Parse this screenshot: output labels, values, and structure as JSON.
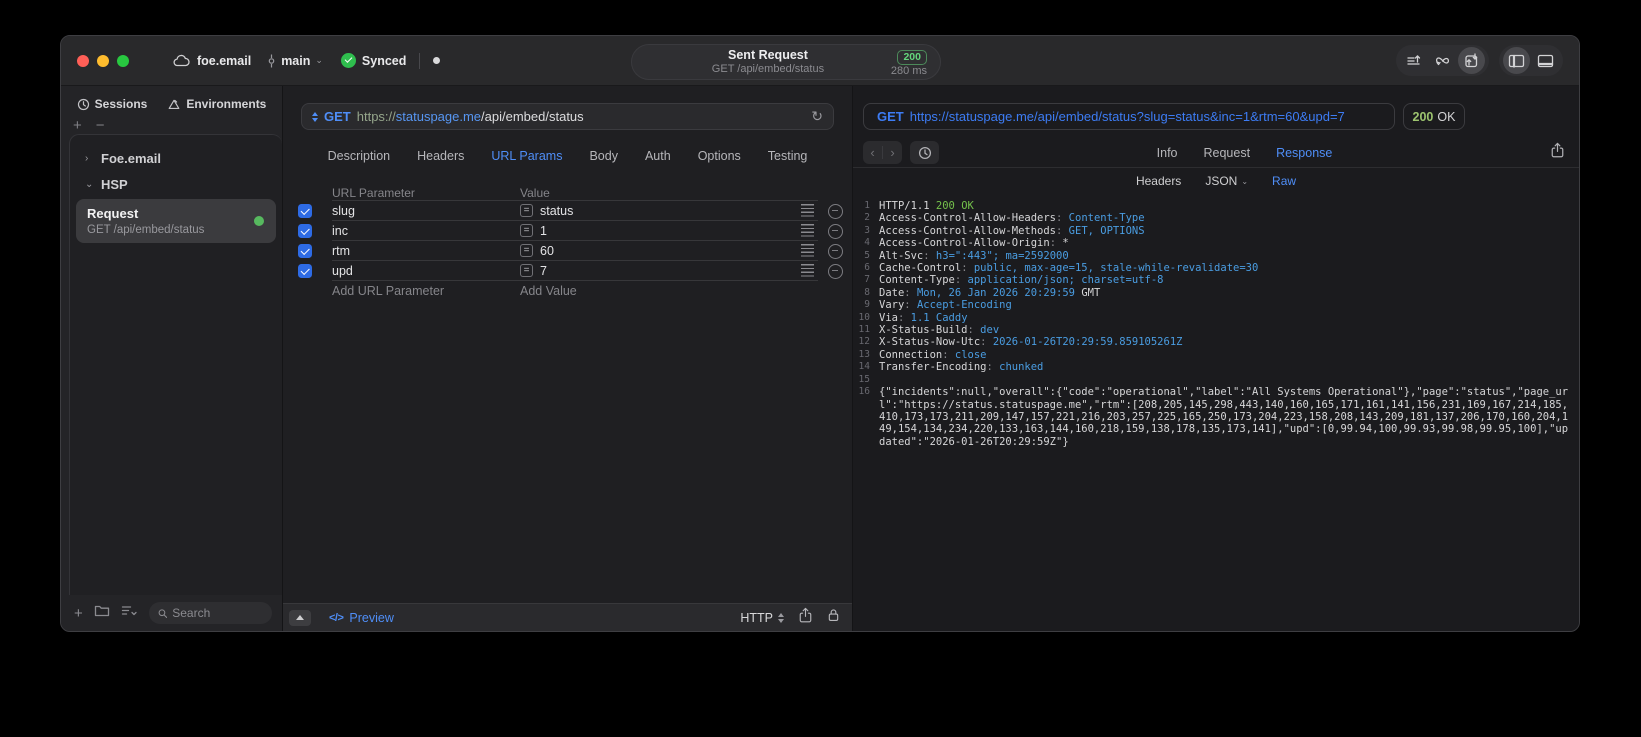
{
  "colors": {
    "accent_blue": "#4f8ef7",
    "value_blue": "#4a9de2",
    "response_green": "#74c14b",
    "badge_green": "#64d67c",
    "traffic_red": "#ff5f57",
    "traffic_yellow": "#febc2e",
    "traffic_green": "#28c840"
  },
  "icons": {
    "cloud": "cloud-outline",
    "branch": "git-commit",
    "synced": "check-circle",
    "list_up": "lines-arrow-up",
    "loop": "loop-arrows",
    "transfer": "box-transfer-arrows",
    "sidebar_left": "panel-left",
    "panel_bottom": "panel-bottom",
    "sessions": "clock",
    "environments": "triangle",
    "search": "magnifier",
    "refresh": "↻",
    "preview_code": "</>",
    "share": "square-arrow-up",
    "lock": "padlock",
    "history": "clock",
    "back": "‹",
    "forward": "›",
    "chevron_down": "⌄",
    "chevron_right": "›",
    "equals": "=",
    "remove": "minus-circle",
    "drag": "hamburger-lines"
  },
  "titlebar": {
    "project": "foe.email",
    "branch": "main",
    "sync_label": "Synced",
    "request": {
      "title": "Sent Request",
      "subtitle": "GET /api/embed/status",
      "status": "200",
      "duration": "280 ms"
    }
  },
  "sidebar": {
    "tabs": [
      {
        "label": "Sessions"
      },
      {
        "label": "Environments"
      }
    ],
    "tree": {
      "group1": "Foe.email",
      "group2": "HSP"
    },
    "request_item": {
      "title": "Request",
      "subtitle": "GET /api/embed/status"
    },
    "search_placeholder": "Search"
  },
  "request_editor": {
    "method": "GET",
    "url": {
      "scheme": "https://",
      "host": "statuspage.me",
      "path": "/api/embed/status"
    },
    "tabs": [
      "Description",
      "Headers",
      "URL Params",
      "Body",
      "Auth",
      "Options",
      "Testing"
    ],
    "active_tab": "URL Params",
    "params": {
      "columns": [
        "URL Parameter",
        "Value"
      ],
      "rows": [
        {
          "enabled": true,
          "name": "slug",
          "value": "status"
        },
        {
          "enabled": true,
          "name": "inc",
          "value": "1"
        },
        {
          "enabled": true,
          "name": "rtm",
          "value": "60"
        },
        {
          "enabled": true,
          "name": "upd",
          "value": "7"
        }
      ],
      "add_row": {
        "name_placeholder": "Add URL Parameter",
        "value_placeholder": "Add Value"
      }
    },
    "footer": {
      "preview_label": "Preview",
      "protocol_label": "HTTP"
    }
  },
  "response_viewer": {
    "request_line": {
      "method": "GET",
      "url": "https://statuspage.me/api/embed/status?slug=status&inc=1&rtm=60&upd=7"
    },
    "status": {
      "code": "200",
      "text": "OK"
    },
    "tabs": [
      "Info",
      "Request",
      "Response"
    ],
    "active_tab": "Response",
    "subtabs": [
      "Headers",
      "JSON",
      "Raw"
    ],
    "active_subtab": "Raw",
    "lines": [
      {
        "num": 1,
        "segments": [
          {
            "text": "HTTP/1.1 ",
            "style": "plain"
          },
          {
            "text": "200 OK",
            "style": "green"
          }
        ]
      },
      {
        "num": 2,
        "segments": [
          {
            "text": "Access-Control-Allow-Headers",
            "style": "key"
          },
          {
            "text": ": ",
            "style": "dim"
          },
          {
            "text": "Content-Type",
            "style": "value"
          }
        ]
      },
      {
        "num": 3,
        "segments": [
          {
            "text": "Access-Control-Allow-Methods",
            "style": "key"
          },
          {
            "text": ": ",
            "style": "dim"
          },
          {
            "text": "GET, OPTIONS",
            "style": "value"
          }
        ]
      },
      {
        "num": 4,
        "segments": [
          {
            "text": "Access-Control-Allow-Origin",
            "style": "key"
          },
          {
            "text": ": ",
            "style": "dim"
          },
          {
            "text": "*",
            "style": "plain"
          }
        ]
      },
      {
        "num": 5,
        "segments": [
          {
            "text": "Alt-Svc",
            "style": "key"
          },
          {
            "text": ": ",
            "style": "dim"
          },
          {
            "text": "h3=\":443\"; ma=2592000",
            "style": "value"
          }
        ]
      },
      {
        "num": 6,
        "segments": [
          {
            "text": "Cache-Control",
            "style": "key"
          },
          {
            "text": ": ",
            "style": "dim"
          },
          {
            "text": "public, max-age=15, stale-while-revalidate=30",
            "style": "value"
          }
        ]
      },
      {
        "num": 7,
        "segments": [
          {
            "text": "Content-Type",
            "style": "key"
          },
          {
            "text": ": ",
            "style": "dim"
          },
          {
            "text": "application/json; charset=utf-8",
            "style": "value"
          }
        ]
      },
      {
        "num": 8,
        "segments": [
          {
            "text": "Date",
            "style": "key"
          },
          {
            "text": ": ",
            "style": "dim"
          },
          {
            "text": "Mon, 26 Jan 2026 20:29:59 ",
            "style": "value"
          },
          {
            "text": "GMT",
            "style": "plain"
          }
        ]
      },
      {
        "num": 9,
        "segments": [
          {
            "text": "Vary",
            "style": "key"
          },
          {
            "text": ": ",
            "style": "dim"
          },
          {
            "text": "Accept-Encoding",
            "style": "value"
          }
        ]
      },
      {
        "num": 10,
        "segments": [
          {
            "text": "Via",
            "style": "key"
          },
          {
            "text": ": ",
            "style": "dim"
          },
          {
            "text": "1.1 Caddy",
            "style": "value"
          }
        ]
      },
      {
        "num": 11,
        "segments": [
          {
            "text": "X-Status-Build",
            "style": "key"
          },
          {
            "text": ": ",
            "style": "dim"
          },
          {
            "text": "dev",
            "style": "value"
          }
        ]
      },
      {
        "num": 12,
        "segments": [
          {
            "text": "X-Status-Now-Utc",
            "style": "key"
          },
          {
            "text": ": ",
            "style": "dim"
          },
          {
            "text": "2026-01-26T20:29:59.859105261Z",
            "style": "value"
          }
        ]
      },
      {
        "num": 13,
        "segments": [
          {
            "text": "Connection",
            "style": "key"
          },
          {
            "text": ": ",
            "style": "dim"
          },
          {
            "text": "close",
            "style": "value"
          }
        ]
      },
      {
        "num": 14,
        "segments": [
          {
            "text": "Transfer-Encoding",
            "style": "key"
          },
          {
            "text": ": ",
            "style": "dim"
          },
          {
            "text": "chunked",
            "style": "value"
          }
        ]
      },
      {
        "num": 15,
        "segments": []
      },
      {
        "num": 16,
        "segments": [
          {
            "text": "{\"incidents\":null,\"overall\":{\"code\":\"operational\",\"label\":\"All Systems Operational\"},\"page\":\"status\",\"page_url\":\"https://status.statuspage.me\",\"rtm\":[208,205,145,298,443,140,160,165,171,161,141,156,231,169,167,214,185,410,173,173,211,209,147,157,221,216,203,257,225,165,250,173,204,223,158,208,143,209,181,137,206,170,160,204,149,154,134,234,220,133,163,144,160,218,159,138,178,135,173,141],\"upd\":[0,99.94,100,99.93,99.98,99.95,100],\"updated\":\"2026-01-26T20:29:59Z\"}",
            "style": "plain"
          }
        ]
      }
    ]
  }
}
